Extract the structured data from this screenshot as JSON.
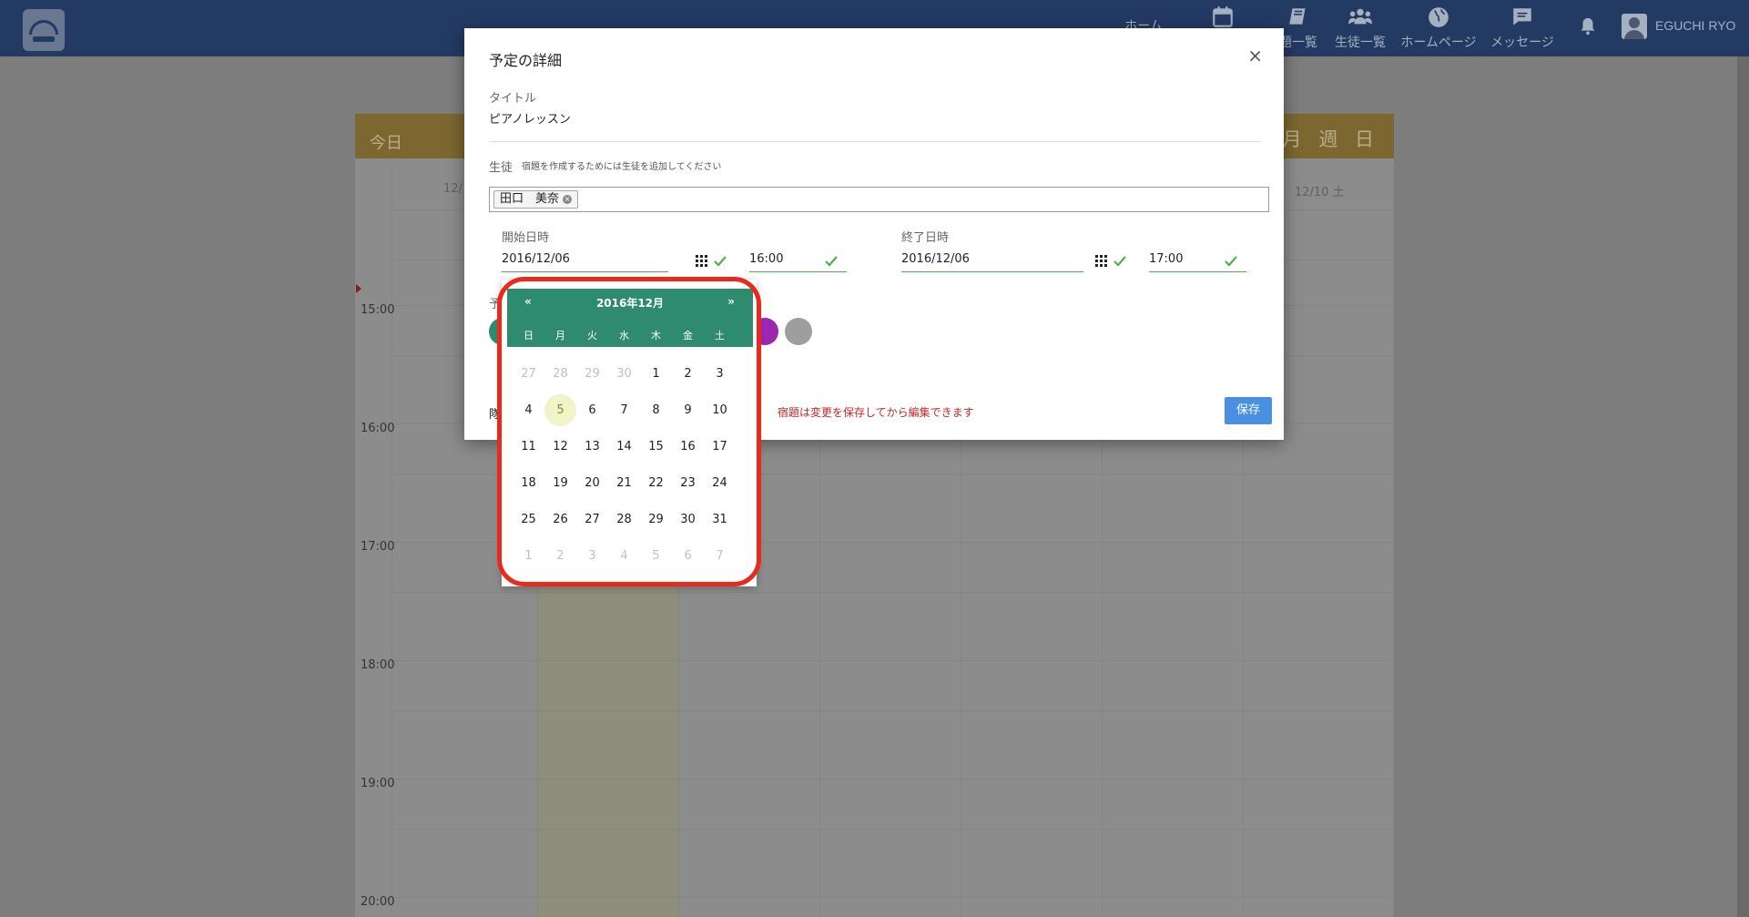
{
  "nav": {
    "items": [
      {
        "label": "ホーム",
        "icon": "home-icon"
      },
      {
        "label": "",
        "icon": "calendar-icon"
      },
      {
        "label": "題一覧",
        "icon": "book-icon"
      },
      {
        "label": "生徒一覧",
        "icon": "students-icon"
      },
      {
        "label": "ホームページ",
        "icon": "globe-icon"
      },
      {
        "label": "メッセージ",
        "icon": "message-icon"
      }
    ],
    "username": "EGUCHI RYO"
  },
  "calendar": {
    "today_label": "今日",
    "views": "月 週 日",
    "day_first": "12/",
    "day_last": "12/10 土",
    "times": [
      "15:00",
      "16:00",
      "17:00",
      "18:00",
      "19:00",
      "20:00"
    ]
  },
  "modal": {
    "title": "予定の詳細",
    "close": "×",
    "title_label": "タイトル",
    "title_value": "ピアノレッスン",
    "student_label": "生徒",
    "student_hint": "宿題を作成するためには生徒を追加してください",
    "student_chip": "田口　美奈",
    "start_label": "開始日時",
    "start_date": "2016/12/06",
    "start_time": "16:00",
    "end_label": "終了日時",
    "end_date": "2016/12/06",
    "end_time": "17:00",
    "schedule_label_partial": "予",
    "bottom_label_partial": "隊",
    "warning": "宿題は変更を保存してから編集できます",
    "save": "保存",
    "colors": [
      "#2e8b6e",
      "#9c27b0",
      "#9e9e9e"
    ]
  },
  "datepicker": {
    "prev": "«",
    "next": "»",
    "month": "2016年12月",
    "weekdays": [
      "日",
      "月",
      "火",
      "水",
      "木",
      "金",
      "土"
    ],
    "weeks": [
      [
        "27",
        "28",
        "29",
        "30",
        "1",
        "2",
        "3"
      ],
      [
        "4",
        "5",
        "6",
        "7",
        "8",
        "9",
        "10"
      ],
      [
        "11",
        "12",
        "13",
        "14",
        "15",
        "16",
        "17"
      ],
      [
        "18",
        "19",
        "20",
        "21",
        "22",
        "23",
        "24"
      ],
      [
        "25",
        "26",
        "27",
        "28",
        "29",
        "30",
        "31"
      ],
      [
        "1",
        "2",
        "3",
        "4",
        "5",
        "6",
        "7"
      ]
    ],
    "muted_first_row_count": 4,
    "muted_last_row": true,
    "today": "5",
    "accent": "#2e8b6e"
  }
}
